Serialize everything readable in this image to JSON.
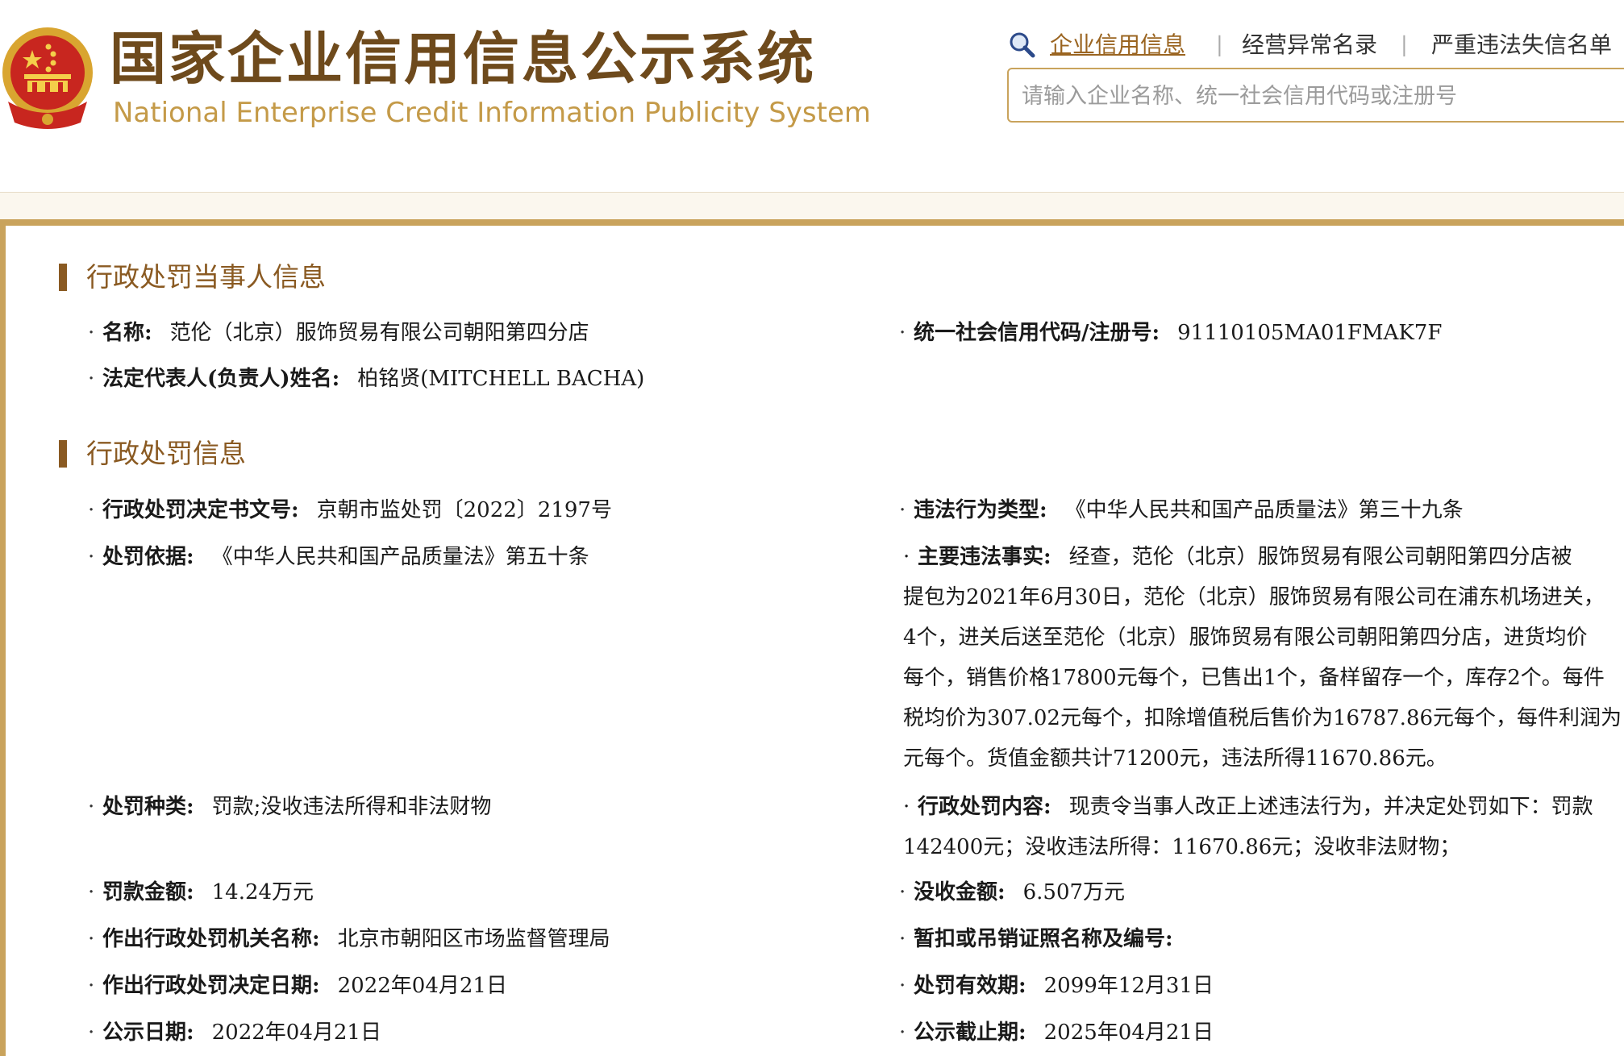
{
  "header": {
    "title_cn": "国家企业信用信息公示系统",
    "title_en": "National Enterprise Credit Information Publicity System",
    "nav": [
      "企业信用信息",
      "经营异常名录",
      "严重违法失信名单"
    ],
    "search_placeholder": "请输入企业名称、统一社会信用代码或注册号",
    "colors": {
      "brand": "#6e4a1c",
      "accent": "#c9a35c",
      "link": "#9a6420"
    }
  },
  "party": {
    "section_title": "行政处罚当事人信息",
    "name_label": "名称:",
    "name_value": "范伦（北京）服饰贸易有限公司朝阳第四分店",
    "code_label": "统一社会信用代码/注册号:",
    "code_value": "91110105MA01FMAK7F",
    "rep_label": "法定代表人(负责人)姓名:",
    "rep_value": "柏铭贤(MITCHELL BACHA)"
  },
  "penalty": {
    "section_title": "行政处罚信息",
    "doc_no_label": "行政处罚决定书文号:",
    "doc_no_value": "京朝市监处罚〔2022〕2197号",
    "violation_type_label": "违法行为类型:",
    "violation_type_value": "《中华人民共和国产品质量法》第三十九条",
    "basis_label": "处罚依据:",
    "basis_value": "《中华人民共和国产品质量法》第五十条",
    "facts_label": "主要违法事实:",
    "facts_lines": [
      "经查，范伦（北京）服饰贸易有限公司朝阳第四分店被",
      "提包为2021年6月30日，范伦（北京）服饰贸易有限公司在浦东机场进关，",
      "4个，进关后送至范伦（北京）服饰贸易有限公司朝阳第四分店，进货均价",
      "每个，销售价格17800元每个，已售出1个，备样留存一个，库存2个。每件",
      "税均价为307.02元每个，扣除增值税后售价为16787.86元每个，每件利润为",
      "元每个。货值金额共计71200元，违法所得11670.86元。"
    ],
    "kind_label": "处罚种类:",
    "kind_value": "罚款;没收违法所得和非法财物",
    "content_label": "行政处罚内容:",
    "content_lines": [
      "现责令当事人改正上述违法行为，并决定处罚如下：罚款",
      "142400元；没收违法所得：11670.86元；没收非法财物；"
    ],
    "fine_label": "罚款金额:",
    "fine_value": "14.24万元",
    "confiscation_label": "没收金额:",
    "confiscation_value": "6.507万元",
    "authority_label": "作出行政处罚机关名称:",
    "authority_value": "北京市朝阳区市场监督管理局",
    "license_label": "暂扣或吊销证照名称及编号:",
    "license_value": "",
    "decision_date_label": "作出行政处罚决定日期:",
    "decision_date_value": "2022年04月21日",
    "validity_label": "处罚有效期:",
    "validity_value": "2099年12月31日",
    "publish_date_label": "公示日期:",
    "publish_date_value": "2022年04月21日",
    "publish_end_label": "公示截止期:",
    "publish_end_value": "2025年04月21日"
  }
}
